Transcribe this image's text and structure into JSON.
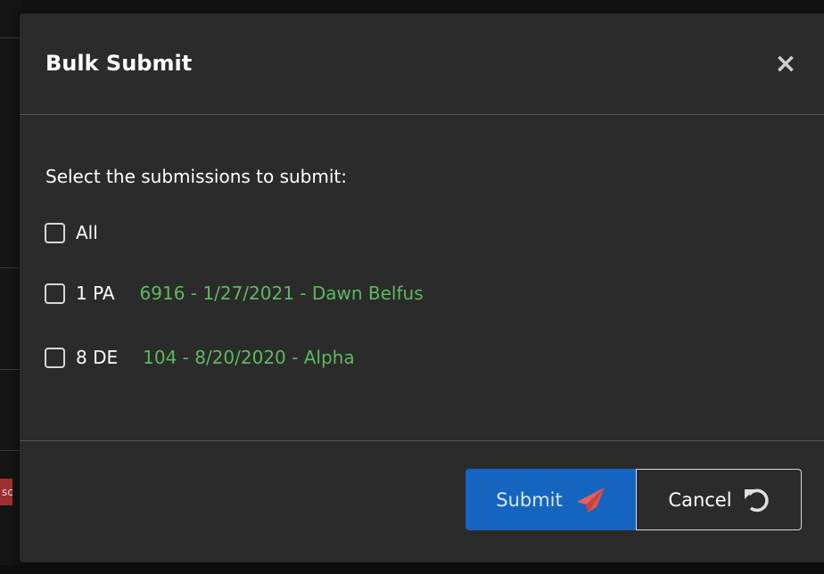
{
  "background": {
    "badge_text": "sc"
  },
  "modal": {
    "title": "Bulk Submit",
    "close_label": "×",
    "prompt": "Select the submissions to submit:",
    "options": [
      {
        "label": "All",
        "detail": "",
        "checked": false
      },
      {
        "label": "1 PA",
        "detail": "6916 - 1/27/2021 - Dawn Belfus",
        "checked": false
      },
      {
        "label": "8 DE",
        "detail": "104 - 8/20/2020 - Alpha",
        "checked": false
      }
    ],
    "buttons": {
      "submit_label": "Submit",
      "submit_icon": "paper-plane-icon",
      "cancel_label": "Cancel",
      "cancel_icon": "undo-icon"
    }
  },
  "colors": {
    "modal_bg": "#2b2b2b",
    "submit_bg": "#1565c0",
    "detail_text": "#5fb85f",
    "plane_icon": "#d9534f"
  }
}
